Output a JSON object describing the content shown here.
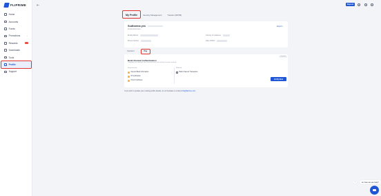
{
  "app": {
    "name": "FLIPRIME"
  },
  "sidebar": {
    "items": [
      {
        "label": "Home",
        "icon": "home-icon"
      },
      {
        "label": "Accounts",
        "icon": "accounts-icon"
      },
      {
        "label": "Funds",
        "icon": "funds-icon"
      },
      {
        "label": "Promotions",
        "icon": "gift-icon"
      },
      {
        "label": "Rewards",
        "icon": "trophy-icon"
      },
      {
        "label": "Downloads",
        "icon": "download-icon"
      },
      {
        "label": "Tools",
        "icon": "tools-icon"
      },
      {
        "label": "Profile",
        "icon": "user-icon"
      },
      {
        "label": "Support",
        "icon": "support-icon"
      }
    ]
  },
  "topbar": {
    "deposit_label": "Deposit"
  },
  "tabs": [
    {
      "label": "My Profile"
    },
    {
      "label": "Security Management"
    },
    {
      "label": "Transfer (IBT/IB)"
    }
  ],
  "profile": {
    "name": "Sudharma yes",
    "account_type": "Personal Account",
    "export_label": "Export",
    "fields": {
      "email_label": "Email Address",
      "phone_label": "Phone Number",
      "country_label": "Country of residence",
      "dob_label": "Date of Birth"
    }
  },
  "subtabs": [
    {
      "label": "Standard"
    },
    {
      "label": "Pay"
    }
  ],
  "verification": {
    "status": "Unverified",
    "title": "Bank Channel Authentication",
    "description": "Complete the info/auth once and check the link to Bank Transfer method.",
    "requirements_heading": "Requirements",
    "methods_heading": "Methods",
    "requirements": [
      "Deposit Bank Information",
      "ID Verification",
      "Proof of Address"
    ],
    "method": "Bank Channel Transaction",
    "verify_label": "Verify Now"
  },
  "footnote": {
    "text": "If you wish to update your existing profile details, do not hesitate to contact",
    "link": "info@fliprime.com"
  },
  "chat": {
    "prompt": "Hi, how can we help?",
    "close": "×"
  }
}
